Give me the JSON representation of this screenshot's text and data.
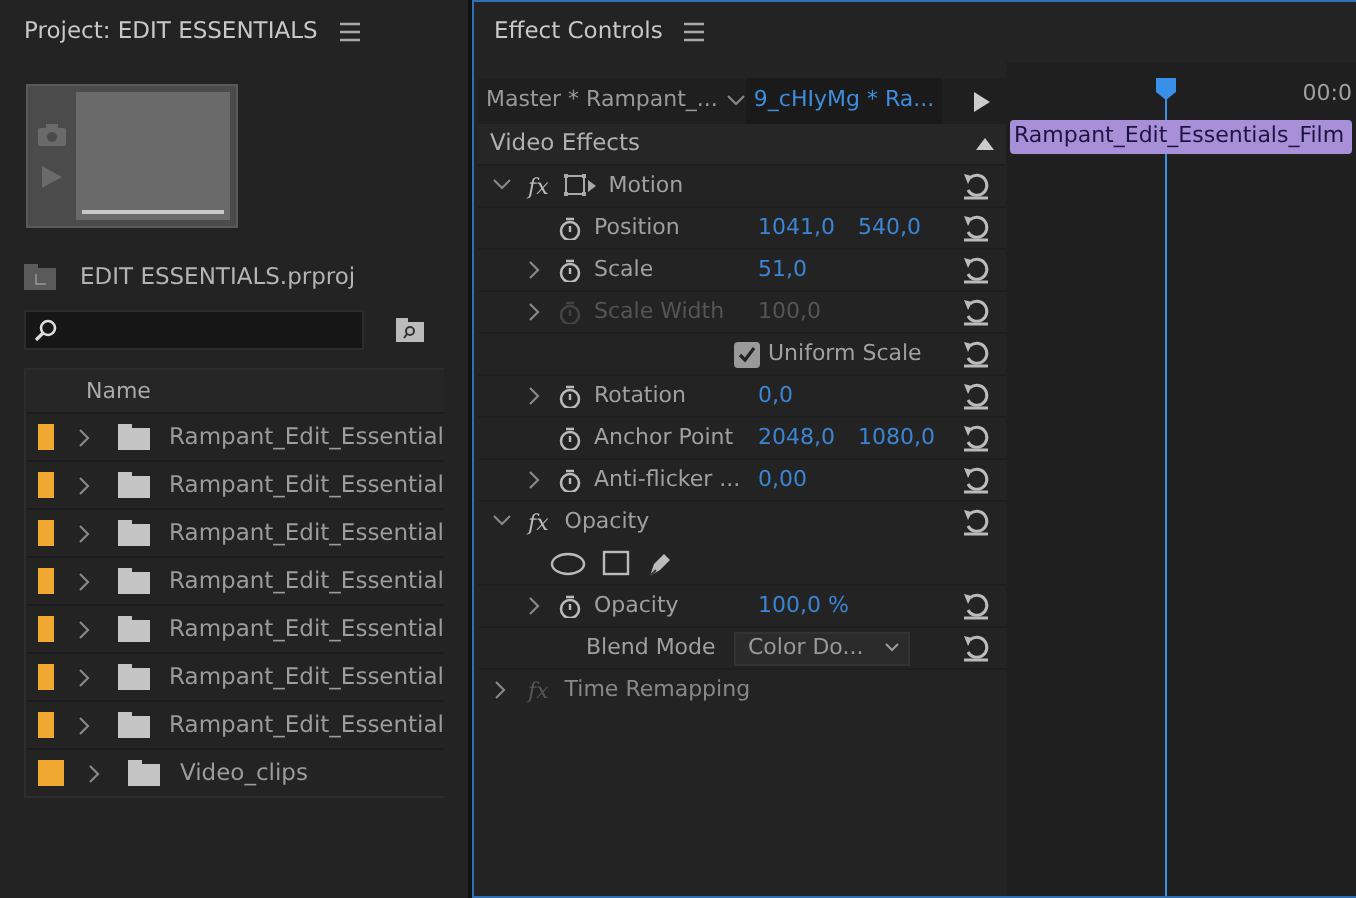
{
  "project": {
    "title": "Project: EDIT ESSENTIALS",
    "file": "EDIT ESSENTIALS.prproj",
    "columns": [
      "Name"
    ],
    "items": [
      {
        "name": "Rampant_Edit_Essential",
        "color": "#f0a830"
      },
      {
        "name": "Rampant_Edit_Essential",
        "color": "#f0a830"
      },
      {
        "name": "Rampant_Edit_Essential",
        "color": "#f0a830"
      },
      {
        "name": "Rampant_Edit_Essential",
        "color": "#f0a830"
      },
      {
        "name": "Rampant_Edit_Essential",
        "color": "#f0a830"
      },
      {
        "name": "Rampant_Edit_Essential",
        "color": "#f0a830"
      },
      {
        "name": "Rampant_Edit_Essential",
        "color": "#f0a830"
      },
      {
        "name": "Video_clips",
        "color": "#f0a830"
      }
    ]
  },
  "effect_controls": {
    "title": "Effect Controls",
    "tabs": [
      {
        "label": "Master * Rampant_...",
        "selected": false
      },
      {
        "label": "9_cHIyMg * Ra...",
        "selected": true
      }
    ],
    "timecode": "00:0",
    "clip": "Rampant_Edit_Essentials_Film",
    "section": "Video Effects",
    "rows": [
      {
        "kind": "effect",
        "fx": "fx",
        "name": "Motion",
        "expanded": true,
        "enabled": true,
        "transform_icon": true,
        "no_reset": false
      },
      {
        "kind": "property",
        "name": "Position",
        "values": [
          "1041,0",
          "540,0"
        ],
        "expandable": false,
        "disabled": false
      },
      {
        "kind": "property",
        "name": "Scale",
        "values": [
          "51,0"
        ],
        "expandable": true,
        "disabled": false
      },
      {
        "kind": "property",
        "name": "Scale Width",
        "values": [
          "100,0"
        ],
        "expandable": true,
        "disabled": true
      },
      {
        "kind": "checkbox",
        "label": "Uniform Scale",
        "checked": true
      },
      {
        "kind": "property",
        "name": "Rotation",
        "values": [
          "0,0"
        ],
        "expandable": true,
        "disabled": false
      },
      {
        "kind": "property",
        "name": "Anchor Point",
        "values": [
          "2048,0",
          "1080,0"
        ],
        "expandable": false,
        "disabled": false
      },
      {
        "kind": "property",
        "name": "Anti-flicker ...",
        "values": [
          "0,00"
        ],
        "expandable": true,
        "disabled": false
      },
      {
        "kind": "effect",
        "fx": "fx",
        "name": "Opacity",
        "expanded": true,
        "enabled": true,
        "transform_icon": false,
        "no_reset": false
      },
      {
        "kind": "masks"
      },
      {
        "kind": "property",
        "name": "Opacity",
        "values": [
          "100,0 %"
        ],
        "expandable": true,
        "disabled": false
      },
      {
        "kind": "dropdown",
        "name": "Blend Mode",
        "value": "Color Do..."
      },
      {
        "kind": "effect",
        "fx": "fx",
        "name": "Time Remapping",
        "expanded": false,
        "enabled": false,
        "transform_icon": false,
        "no_reset": true
      }
    ]
  }
}
